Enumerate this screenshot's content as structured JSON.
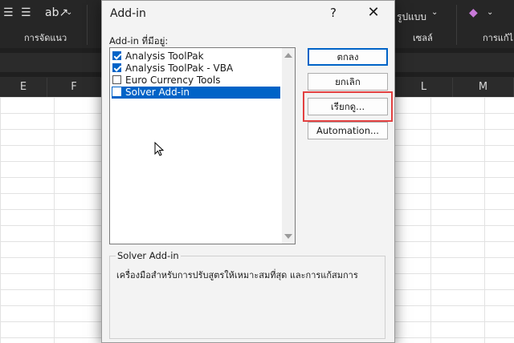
{
  "ribbon": {
    "groups": [
      {
        "label": "การจัดแนว"
      },
      {
        "label": "รูปแบบ"
      },
      {
        "label": "เซลล์"
      },
      {
        "label": "การแก้ไ"
      }
    ]
  },
  "columns": [
    "E",
    "F",
    "L",
    "M"
  ],
  "dialog": {
    "title": "Add-in",
    "help": "?",
    "close": "✕",
    "list_label": "Add-in ที่มีอยู่:",
    "items": [
      {
        "label": "Analysis ToolPak",
        "checked": true
      },
      {
        "label": "Analysis ToolPak - VBA",
        "checked": true
      },
      {
        "label": "Euro Currency Tools",
        "checked": false
      },
      {
        "label": "Solver Add-in",
        "checked": false,
        "selected": true
      }
    ],
    "buttons": {
      "ok": "ตกลง",
      "cancel": "ยกเลิก",
      "browse": "เรียกดู...",
      "automation": "Automation..."
    },
    "description": {
      "title": "Solver Add-in",
      "text": "เครื่องมือสำหรับการปรับสูตรให้เหมาะสมที่สุด และการแก้สมการ"
    }
  }
}
